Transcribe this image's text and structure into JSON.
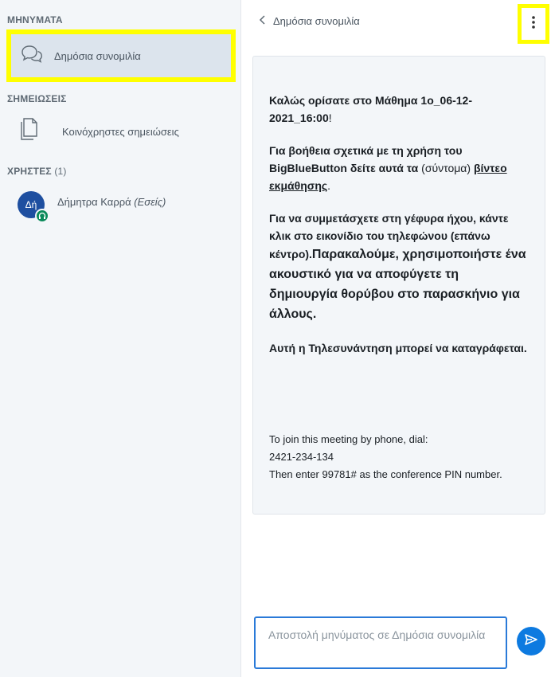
{
  "sidebar": {
    "messages_title": "ΜΗΝΥΜΑΤΑ",
    "public_chat_label": "Δημόσια συνομιλία",
    "notes_title": "ΣΗΜΕΙΩΣΕΙΣ",
    "shared_notes_label": "Κοινόχρηστες σημειώσεις",
    "users_title": "ΧΡΗΣΤΕΣ",
    "users_count": "(1)",
    "user": {
      "initials": "Δή",
      "name": "Δήμητρα Καρρά",
      "you_tag": "(Εσείς)"
    }
  },
  "chat": {
    "header_title": "Δημόσια συνομιλία",
    "welcome": {
      "p1_a": "Καλώς ορίσατε στο ",
      "p1_b": "Μάθημα 1ο_06-12-2021_16:00",
      "p1_c": "!",
      "p2_a": "Για βοήθεια σχετικά με τη χρήση του BigBlueButton ",
      "p2_b": "δείτε αυτά τα",
      "p2_c": " (σύντομα) ",
      "p2_d": "βίντεο εκμάθησης",
      "p2_e": ".",
      "p3_a": "Για να συμμετάσχετε στη γέφυρα ήχου, κάντε κλικ στο εικονίδιο του τηλεφώνου (επάνω κέντρο).",
      "p3_b": "Παρακαλούμε, χρησιμοποιήστε ένα ακουστικό για να αποφύγετε τη δημιουργία θορύβου στο παρασκήνιο για άλλους.",
      "p4": "Αυτή η Τηλεσυνάντηση μπορεί να καταγράφεται.",
      "phone_1": "To join this meeting by phone, dial:",
      "phone_2": "2421-234-134",
      "phone_3": "Then enter 99781# as the conference PIN number."
    },
    "input_placeholder": "Αποστολή μηνύματος σε Δημόσια συνομιλία"
  },
  "colors": {
    "highlight": "#ffff00",
    "accent": "#0d7ae0",
    "avatar": "#1e4fa0",
    "audio_badge": "#0a8a5a"
  },
  "icons": {
    "public_chat": "chat-bubbles-icon",
    "shared_notes": "documents-icon",
    "audio": "headphones-icon",
    "back": "chevron-left-icon",
    "options": "vertical-dots-icon",
    "send": "send-icon"
  }
}
